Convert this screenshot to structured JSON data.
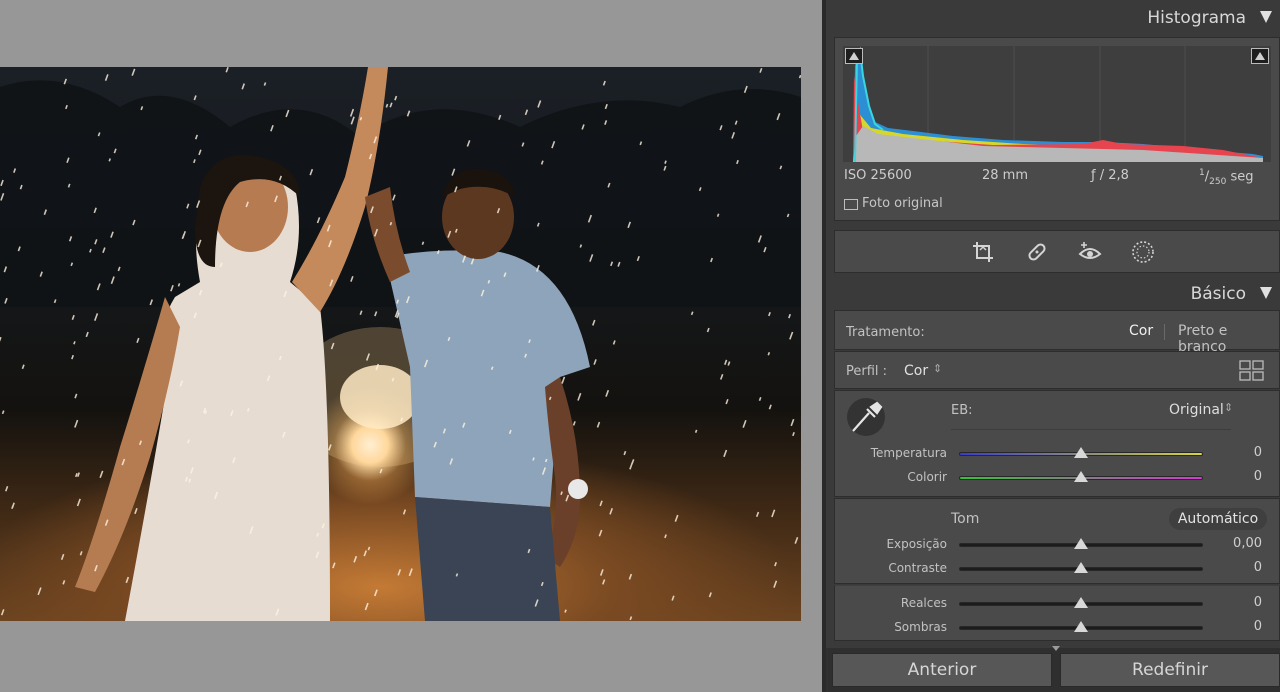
{
  "histogram": {
    "title": "Histograma",
    "iso": "ISO 25600",
    "focal": "28 mm",
    "aperture": "ƒ / 2,8",
    "shutter_num": "1",
    "shutter_den": "250",
    "shutter_unit": "seg",
    "original_label": "Foto original",
    "original_checked": false
  },
  "tools": [
    "crop-icon",
    "healing-icon",
    "redeye-icon",
    "mask-icon"
  ],
  "basic": {
    "title": "Básico",
    "treatment_label": "Tratamento:",
    "treatment_color": "Cor",
    "treatment_bw": "Preto e branco",
    "profile_label": "Perfil :",
    "profile_value": "Cor",
    "wb_label": "EB:",
    "wb_value": "Original",
    "temperature": {
      "label": "Temperatura",
      "value": "0",
      "fraction": 0.5
    },
    "tint": {
      "label": "Colorir",
      "value": "0",
      "fraction": 0.5
    },
    "tone_label": "Tom",
    "auto_label": "Automático",
    "exposure": {
      "label": "Exposição",
      "value": "0,00",
      "fraction": 0.5
    },
    "contrast": {
      "label": "Contraste",
      "value": "0",
      "fraction": 0.5
    },
    "highlights": {
      "label": "Realces",
      "value": "0",
      "fraction": 0.5
    },
    "shadows": {
      "label": "Sombras",
      "value": "0",
      "fraction": 0.5
    }
  },
  "footer": {
    "previous_label": "Anterior",
    "reset_label": "Redefinir"
  },
  "colors": {
    "panel_bg": "#3a3a3a",
    "box_bg": "#4a4a4a",
    "temp_left": "#3b3bd0",
    "temp_right": "#d6d63a",
    "tint_left": "#36c236",
    "tint_right": "#d23ad2"
  }
}
